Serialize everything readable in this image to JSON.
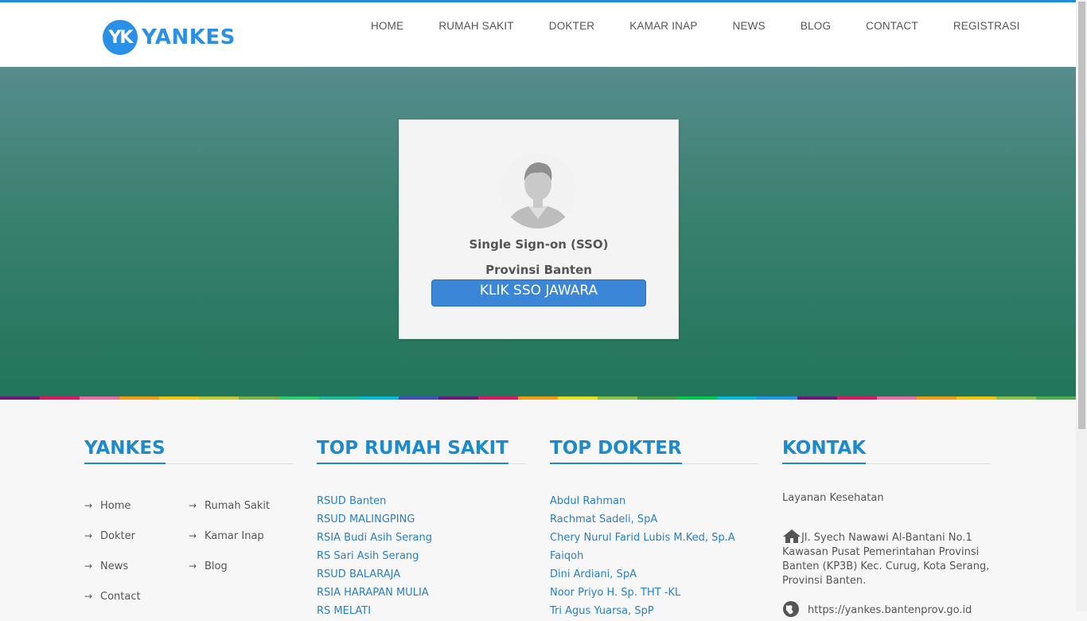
{
  "brand": {
    "badge": "YK",
    "name": "YANKES"
  },
  "nav": [
    "HOME",
    "RUMAH SAKIT",
    "DOKTER",
    "KAMAR INAP",
    "NEWS",
    "BLOG",
    "CONTACT",
    "REGISTRASI"
  ],
  "sso": {
    "title_line1": "Single Sign-on (SSO)",
    "title_line2": "Provinsi Banten",
    "button_label": "KLIK SSO JAWARA"
  },
  "colors": {
    "accent": "#1c8acb",
    "hero_top": "#578c8e",
    "hero_bottom": "#21755a",
    "button": "#3b86d6",
    "stripe": [
      "#6a1b7a",
      "#d81b60",
      "#e66aa8",
      "#f39c12",
      "#f1c40f",
      "#c0ca33",
      "#7cb342",
      "#2ecc71",
      "#1abc9c",
      "#00bcd4",
      "#3f51b5",
      "#6a1b7a",
      "#d81b60",
      "#f39c12",
      "#e6df20",
      "#8bc34a",
      "#43a047",
      "#00c853",
      "#00bcd4",
      "#2196f3",
      "#6a1b7a",
      "#d81b60",
      "#e66aa8",
      "#f39c12",
      "#f1c40f",
      "#8bc34a",
      "#4caf50"
    ]
  },
  "footer": {
    "yankes": {
      "title": "YANKES",
      "links": [
        "Home",
        "Rumah Sakit",
        "Dokter",
        "Kamar Inap",
        "News",
        "Blog",
        "Contact"
      ]
    },
    "rumah_sakit": {
      "title": "TOP RUMAH SAKIT",
      "items": [
        "RSUD Banten",
        "RSUD MALINGPING",
        "RSIA Budi Asih Serang",
        "RS Sari Asih Serang",
        "RSUD BALARAJA",
        "RSIA HARAPAN MULIA",
        "RS MELATI"
      ]
    },
    "dokter": {
      "title": "TOP DOKTER",
      "items": [
        "Abdul Rahman",
        "Rachmat Sadeli, SpA",
        "Chery Nurul Farid Lubis M.Ked, Sp.A",
        "Faiqoh",
        "Dini Ardiani, SpA",
        "Noor Priyo H. Sp. THT -KL",
        "Tri Agus Yuarsa, SpP"
      ]
    },
    "kontak": {
      "title": "KONTAK",
      "service": "Layanan Kesehatan",
      "address": "Jl. Syech Nawawi Al-Bantani No.1 Kawasan Pusat Pemerintahan Provinsi Banten (KP3B) Kec. Curug, Kota Serang, Provinsi Banten.",
      "website": "https://yankes.bantenprov.go.id"
    }
  }
}
